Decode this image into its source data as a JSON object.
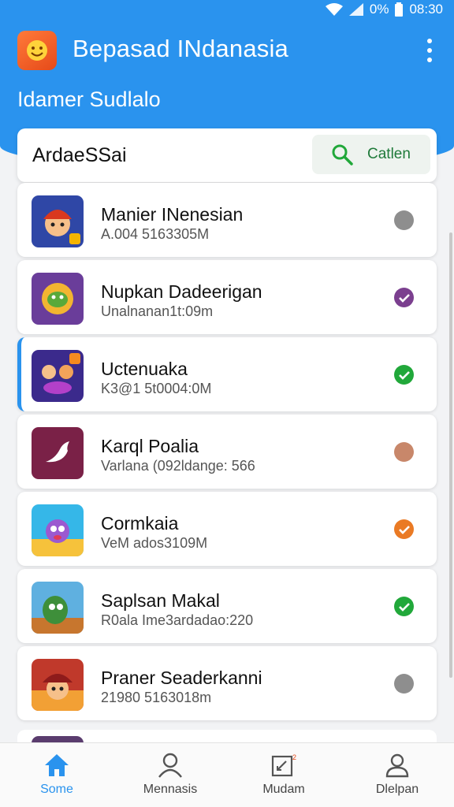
{
  "status_bar": {
    "battery_text": "0%",
    "time": "08:30"
  },
  "header": {
    "app_title": "Bepasad INdanasia",
    "subtitle": "Idamer Sudlalo",
    "menu_icon": "more-vert-icon"
  },
  "search": {
    "value": "ArdaeSSai",
    "button_label": "Catlen",
    "button_icon": "search-icon"
  },
  "items": [
    {
      "name": "Manier INenesian",
      "meta": "A.004 5163305M",
      "status": "idle",
      "status_color": "#8e8e8e"
    },
    {
      "name": "Nupkan Dadeerigan",
      "meta": "Unalnanan1t:09m",
      "status": "checked",
      "status_color": "#7b3f8f"
    },
    {
      "name": "Uctenuaka",
      "meta": "K3@1 5t0004:0M",
      "status": "checked",
      "status_color": "#21a83a"
    },
    {
      "name": "Karql Poalia",
      "meta": "Varlana (092ldange: 566",
      "status": "idle",
      "status_color": "#c8876a"
    },
    {
      "name": "Cormkaia",
      "meta": "VeM ados3109M",
      "status": "checked",
      "status_color": "#ea7a24"
    },
    {
      "name": "Saplsan Makal",
      "meta": "R0ala Ime3ardadao:220",
      "status": "checked",
      "status_color": "#21a83a"
    },
    {
      "name": "Praner Seaderkanni",
      "meta": "21980 5163018m",
      "status": "idle",
      "status_color": "#8e8e8e"
    }
  ],
  "bottom_nav": [
    {
      "label": "Some",
      "icon": "home-icon",
      "active": true
    },
    {
      "label": "Mennasis",
      "icon": "person-icon",
      "active": false
    },
    {
      "label": "Mudam",
      "icon": "edit-note-icon",
      "active": false
    },
    {
      "label": "Dlelpan",
      "icon": "profile-icon",
      "active": false
    }
  ],
  "colors": {
    "primary": "#2a93ee",
    "success": "#21a83a"
  }
}
